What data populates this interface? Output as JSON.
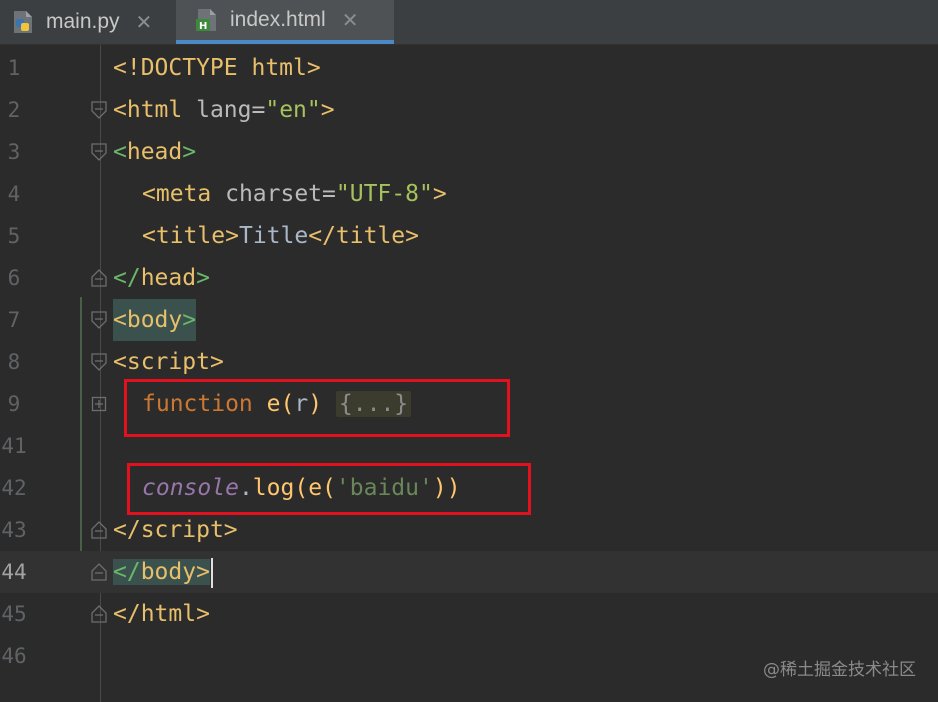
{
  "tabs": [
    {
      "label": "main.py",
      "icon": "python-file-icon"
    },
    {
      "label": "index.html",
      "icon": "html-file-icon",
      "active": true
    }
  ],
  "lines": {
    "l1": {
      "num": "1",
      "doctype": "<!DOCTYPE",
      "rest": " html>"
    },
    "l2": {
      "num": "2",
      "open": "<html",
      "attr": " lang=",
      "val": "\"en\"",
      "close": ">"
    },
    "l3": {
      "num": "3",
      "open": "<",
      "name": "head",
      "close": ">"
    },
    "l4": {
      "num": "4",
      "open": "<meta",
      "attr": " charset=",
      "val": "\"UTF-8\"",
      "close": ">"
    },
    "l5": {
      "num": "5",
      "open": "<",
      "name": "title",
      "gt": ">",
      "text": "Title",
      "close_open": "</",
      "close_name": "title",
      "close_gt": ">"
    },
    "l6": {
      "num": "6",
      "open": "</",
      "name": "head",
      "close": ">"
    },
    "l7": {
      "num": "7",
      "open": "<",
      "name": "body",
      "close": ">"
    },
    "l8": {
      "num": "8",
      "open": "<",
      "name": "script",
      "close": ">"
    },
    "l9": {
      "num": "9",
      "kw": "function",
      "fn": " e(",
      "param": "r",
      "paren": ")",
      "folded": "{...}"
    },
    "l41": {
      "num": "41"
    },
    "l42": {
      "num": "42",
      "obj": "console",
      "dot": ".",
      "method": "log",
      "p1": "(",
      "call": "e(",
      "str": "'baidu'",
      "p2": "))"
    },
    "l43": {
      "num": "43",
      "open": "</",
      "name": "script",
      "close": ">"
    },
    "l44": {
      "num": "44",
      "open": "</",
      "name": "body",
      "close": ">"
    },
    "l45": {
      "num": "45",
      "open": "</",
      "name": "html",
      "close": ">"
    },
    "l46": {
      "num": "46"
    }
  },
  "watermark": "@稀土掘金技术社区",
  "colors": {
    "background": "#2b2b2b",
    "highlight_box": "#e3101e",
    "tag": "#e8bf6a",
    "string": "#a5c25c",
    "keyword": "#cc7832"
  }
}
